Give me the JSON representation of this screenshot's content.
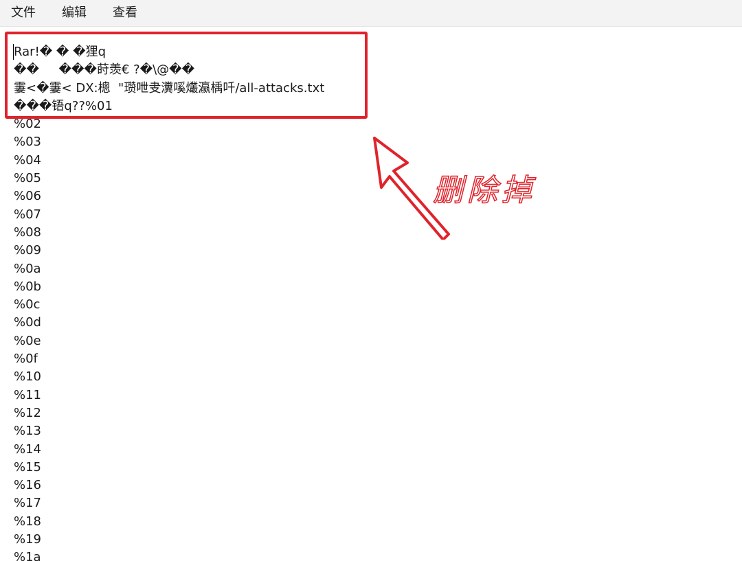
{
  "menu": {
    "items": [
      {
        "label": "文件"
      },
      {
        "label": "编辑"
      },
      {
        "label": "查看"
      }
    ]
  },
  "editor": {
    "lines": [
      "Rar!� � �狸q",
      "��     ���莳羡€ ?�\\@��",
      "霋<�霋< DX:樬  \"瓒呭叏瀵嗘爜瀛楀吀/all-attacks.txt",
      "���铻q??%01",
      "%02",
      "%03",
      "%04",
      "%05",
      "%06",
      "%07",
      "%08",
      "%09",
      "%0a",
      "%0b",
      "%0c",
      "%0d",
      "%0e",
      "%0f",
      "%10",
      "%11",
      "%12",
      "%13",
      "%14",
      "%15",
      "%16",
      "%17",
      "%18",
      "%19",
      "%1a"
    ]
  },
  "annotation": {
    "text": "删除掉",
    "color": "#e0232b"
  },
  "icons": {
    "arrow": "arrow-pointing-up-left-icon"
  }
}
